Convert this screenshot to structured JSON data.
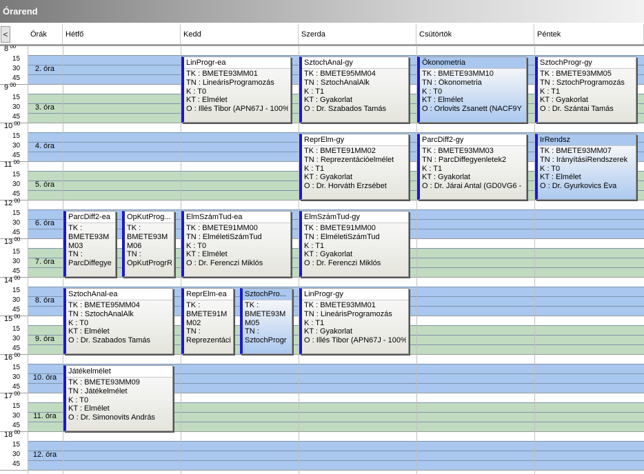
{
  "window": {
    "title": "Órarend"
  },
  "toolbar": {
    "scroll_left": "<"
  },
  "headers": {
    "orak": "Órák",
    "days": [
      "Hétfő",
      "Kedd",
      "Szerda",
      "Csütörtök",
      "Péntek"
    ]
  },
  "hours": [
    "8",
    "9",
    "10",
    "11",
    "12",
    "13",
    "14",
    "15",
    "16",
    "17",
    "18"
  ],
  "hour_suffix": "00",
  "minute_labels": [
    "15",
    "30",
    "45"
  ],
  "periods": [
    "2. óra",
    "3. óra",
    "4. óra",
    "5. óra",
    "6. óra",
    "7. óra",
    "8. óra",
    "9. óra",
    "10. óra",
    "11. óra",
    "12. óra"
  ],
  "colors": {
    "blue_band": "#a9c7ef",
    "green_band": "#c1dbc0",
    "card_stripe": "#1a1acc",
    "title_bar": "#8a8a8a"
  },
  "events": [
    {
      "day": 1,
      "period": 2,
      "span": 2,
      "lane": 0,
      "lanes": 1,
      "style": "white",
      "title": "LinProgr-ea",
      "lines": [
        "TK : BMETE93MM01",
        "TN : LineárisProgramozás",
        "K : T0",
        "KT : Elmélet",
        "O :  Illés Tibor (APN67J - 100%)"
      ]
    },
    {
      "day": 2,
      "period": 2,
      "span": 2,
      "lane": 0,
      "lanes": 1,
      "style": "white",
      "title": "SztochAnal-gy",
      "lines": [
        "TK : BMETE95MM04",
        "TN : SztochAnalAlk",
        "K : T1",
        "KT : Gyakorlat",
        "O :  Dr. Szabados Tamás"
      ]
    },
    {
      "day": 3,
      "period": 2,
      "span": 2,
      "lane": 0,
      "lanes": 1,
      "style": "blue",
      "title": "Ökonometria",
      "lines": [
        "TK : BMETE93MM10",
        "TN : Ökonometria",
        "K : T0",
        "KT : Elmélet",
        "O :  Orlovits Zsanett (NACF9Y -"
      ]
    },
    {
      "day": 4,
      "period": 2,
      "span": 2,
      "lane": 0,
      "lanes": 1,
      "style": "white",
      "title": "SztochProgr-gy",
      "lines": [
        "TK : BMETE93MM05",
        "TN : SztochProgramozás",
        "K : T1",
        "KT : Gyakorlat",
        "O :  Dr. Szántai Tamás"
      ]
    },
    {
      "day": 2,
      "period": 4,
      "span": 2,
      "lane": 0,
      "lanes": 1,
      "style": "white",
      "title": "ReprElm-gy",
      "lines": [
        "TK : BMETE91MM02",
        "TN : Reprezentációelmélet",
        "K : T1",
        "KT : Gyakorlat",
        "O :  Dr. Horváth Erzsébet"
      ]
    },
    {
      "day": 3,
      "period": 4,
      "span": 2,
      "lane": 0,
      "lanes": 1,
      "style": "white",
      "title": "ParcDiff2-gy",
      "lines": [
        "TK : BMETE93MM03",
        "TN : ParcDiffegyenletek2",
        "K : T1",
        "KT : Gyakorlat",
        "O :  Dr. Járai Antal (GD0VG6 -"
      ]
    },
    {
      "day": 4,
      "period": 4,
      "span": 2,
      "lane": 0,
      "lanes": 1,
      "style": "blue",
      "title": "IrRendsz",
      "lines": [
        "TK : BMETE93MM07",
        "TN : IrányításiRendszerek",
        "K : T0",
        "KT : Elmélet",
        "O :  Dr. Gyurkovics Éva"
      ]
    },
    {
      "day": 0,
      "period": 6,
      "span": 2,
      "lane": 0,
      "lanes": 2,
      "style": "white",
      "title": "ParcDiff2-ea",
      "lines": [
        "TK :",
        "BMETE93M",
        "M03",
        "TN :",
        "ParcDiffegye"
      ]
    },
    {
      "day": 0,
      "period": 6,
      "span": 2,
      "lane": 1,
      "lanes": 2,
      "style": "white",
      "title": "OpKutProg...",
      "lines": [
        "TK :",
        "BMETE93M",
        "M06",
        "TN :",
        "OpKutProgrR"
      ]
    },
    {
      "day": 1,
      "period": 6,
      "span": 2,
      "lane": 0,
      "lanes": 1,
      "style": "white",
      "title": "ElmSzámTud-ea",
      "lines": [
        "TK : BMETE91MM00",
        "TN : ElméletiSzámTud",
        "K : T0",
        "KT : Elmélet",
        "O :  Dr. Ferenczi Miklós"
      ]
    },
    {
      "day": 2,
      "period": 6,
      "span": 2,
      "lane": 0,
      "lanes": 1,
      "style": "white",
      "title": "ElmSzámTud-gy",
      "lines": [
        "TK : BMETE91MM00",
        "TN : ElméletiSzámTud",
        "K : T1",
        "KT : Gyakorlat",
        "O :  Dr. Ferenczi Miklós"
      ]
    },
    {
      "day": 0,
      "period": 8,
      "span": 2,
      "lane": 0,
      "lanes": 1,
      "style": "white",
      "title": "SztochAnal-ea",
      "lines": [
        "TK : BMETE95MM04",
        "TN : SztochAnalAlk",
        "K : T0",
        "KT : Elmélet",
        "O :  Dr. Szabados Tamás"
      ]
    },
    {
      "day": 1,
      "period": 8,
      "span": 2,
      "lane": 0,
      "lanes": 2,
      "style": "white",
      "title": "ReprElm-ea",
      "lines": [
        "TK :",
        "BMETE91M",
        "M02",
        "TN :",
        "Reprezentáci"
      ]
    },
    {
      "day": 1,
      "period": 8,
      "span": 2,
      "lane": 1,
      "lanes": 2,
      "style": "blue",
      "title": "SztochPro...",
      "lines": [
        "TK :",
        "BMETE93M",
        "M05",
        "TN :",
        "SztochProgr"
      ]
    },
    {
      "day": 2,
      "period": 8,
      "span": 2,
      "lane": 0,
      "lanes": 1,
      "style": "white",
      "title": "LinProgr-gy",
      "lines": [
        "TK : BMETE93MM01",
        "TN : LineárisProgramozás",
        "K : T1",
        "KT : Gyakorlat",
        "O :  Illés Tibor (APN67J - 100%)"
      ]
    },
    {
      "day": 0,
      "period": 10,
      "span": 2,
      "lane": 0,
      "lanes": 1,
      "style": "white",
      "title": "Játékelmélet",
      "lines": [
        "TK : BMETE93MM09",
        "TN : Játékelmélet",
        "K : T0",
        "KT : Elmélet",
        "O :  Dr. Simonovits András"
      ]
    }
  ]
}
